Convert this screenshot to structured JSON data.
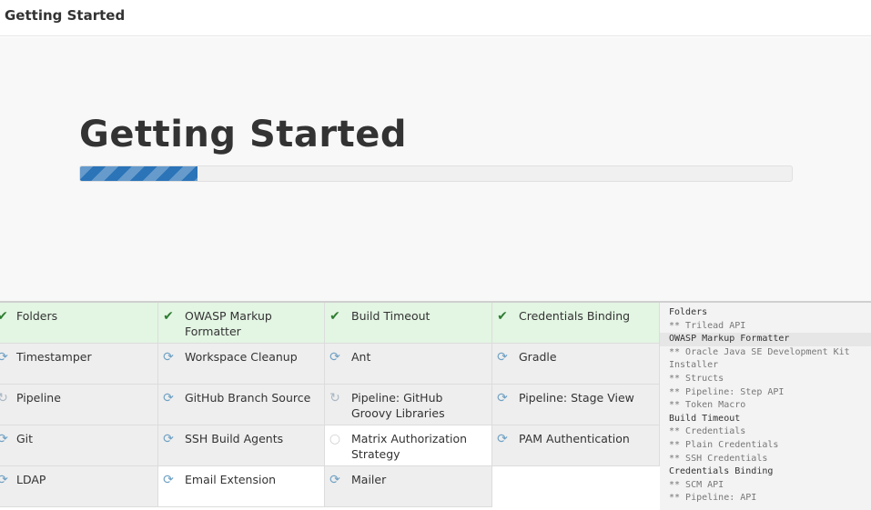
{
  "window": {
    "title": "Getting Started"
  },
  "hero": {
    "heading": "Getting Started",
    "progress_percent": 16.5
  },
  "plugins": [
    {
      "row": 0,
      "col": 0,
      "name": "Folders",
      "status": "success",
      "icon": "check-icon"
    },
    {
      "row": 0,
      "col": 1,
      "name": "OWASP Markup Formatter",
      "status": "success",
      "icon": "check-icon"
    },
    {
      "row": 0,
      "col": 2,
      "name": "Build Timeout",
      "status": "success",
      "icon": "check-icon"
    },
    {
      "row": 0,
      "col": 3,
      "name": "Credentials Binding",
      "status": "success",
      "icon": "check-icon"
    },
    {
      "row": 1,
      "col": 0,
      "name": "Timestamper",
      "status": "pending",
      "icon": "refresh-icon"
    },
    {
      "row": 1,
      "col": 1,
      "name": "Workspace Cleanup",
      "status": "pending",
      "icon": "refresh-icon"
    },
    {
      "row": 1,
      "col": 2,
      "name": "Ant",
      "status": "pending",
      "icon": "refresh-icon"
    },
    {
      "row": 1,
      "col": 3,
      "name": "Gradle",
      "status": "pending",
      "icon": "refresh-icon"
    },
    {
      "row": 2,
      "col": 0,
      "name": "Pipeline",
      "status": "pending",
      "icon": "sync-icon"
    },
    {
      "row": 2,
      "col": 1,
      "name": "GitHub Branch Source",
      "status": "pending",
      "icon": "refresh-icon"
    },
    {
      "row": 2,
      "col": 2,
      "name": "Pipeline: GitHub Groovy Libraries",
      "status": "pending",
      "icon": "sync-icon"
    },
    {
      "row": 2,
      "col": 3,
      "name": "Pipeline: Stage View",
      "status": "pending",
      "icon": "refresh-icon"
    },
    {
      "row": 3,
      "col": 0,
      "name": "Git",
      "status": "pending",
      "icon": "refresh-icon"
    },
    {
      "row": 3,
      "col": 1,
      "name": "SSH Build Agents",
      "status": "pending",
      "icon": "refresh-icon"
    },
    {
      "row": 3,
      "col": 2,
      "name": "Matrix Authorization Strategy",
      "status": "inprog",
      "icon": "circle-icon"
    },
    {
      "row": 3,
      "col": 3,
      "name": "PAM Authentication",
      "status": "pending",
      "icon": "refresh-icon"
    },
    {
      "row": 4,
      "col": 0,
      "name": "LDAP",
      "status": "pending",
      "icon": "refresh-icon"
    },
    {
      "row": 4,
      "col": 1,
      "name": "Email Extension",
      "status": "inprog",
      "icon": "refresh-icon"
    },
    {
      "row": 4,
      "col": 2,
      "name": "Mailer",
      "status": "pending",
      "icon": "refresh-icon"
    }
  ],
  "log": [
    {
      "text": "Folders",
      "type": "main"
    },
    {
      "text": "** Trilead API",
      "type": "sub"
    },
    {
      "text": "OWASP Markup Formatter",
      "type": "main-hl"
    },
    {
      "text": "** Oracle Java SE Development Kit",
      "type": "sub"
    },
    {
      "text": "Installer",
      "type": "sub"
    },
    {
      "text": "** Structs",
      "type": "sub"
    },
    {
      "text": "** Pipeline: Step API",
      "type": "sub"
    },
    {
      "text": "** Token Macro",
      "type": "sub"
    },
    {
      "text": "Build Timeout",
      "type": "main"
    },
    {
      "text": "** Credentials",
      "type": "sub"
    },
    {
      "text": "** Plain Credentials",
      "type": "sub"
    },
    {
      "text": "** SSH Credentials",
      "type": "sub"
    },
    {
      "text": "Credentials Binding",
      "type": "main"
    },
    {
      "text": "** SCM API",
      "type": "sub"
    },
    {
      "text": "** Pipeline: API",
      "type": "sub"
    }
  ]
}
